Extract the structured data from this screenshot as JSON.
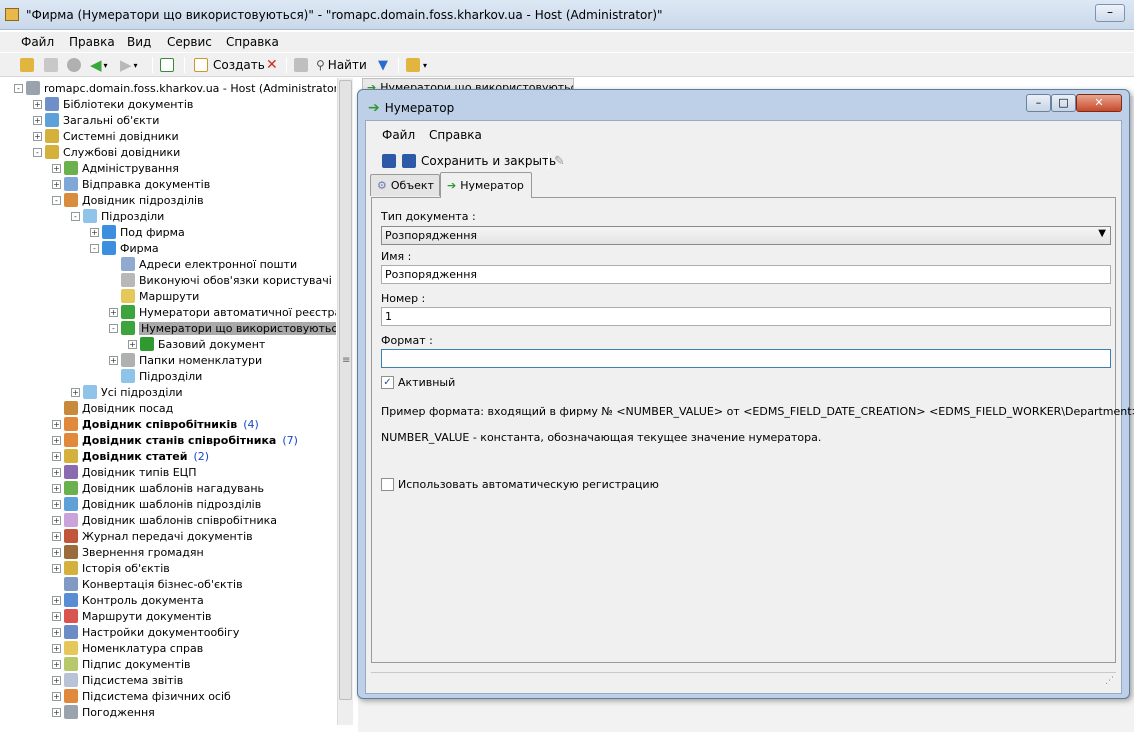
{
  "window": {
    "title": "\"Фирма (Нумератори що використовуються)\" - \"romapc.domain.foss.kharkov.ua - Host (Administrator)\"",
    "min_glyph": "–"
  },
  "menu": [
    "Файл",
    "Правка",
    "Вид",
    "Сервис",
    "Справка"
  ],
  "toolbar": {
    "create_label": "Создать",
    "find_label": "Найти"
  },
  "tree": [
    {
      "label": "romapc.domain.foss.kharkov.ua - Host (Administrator)",
      "depth": 0,
      "exp": "-",
      "icon": "#9aa3ad"
    },
    {
      "label": "Бібліотеки документів",
      "depth": 1,
      "exp": "+",
      "icon": "#6f8fc9"
    },
    {
      "label": "Загальні об'єкти",
      "depth": 1,
      "exp": "+",
      "icon": "#5ea0d8"
    },
    {
      "label": "Системні довідники",
      "depth": 1,
      "exp": "+",
      "icon": "#d4b13d"
    },
    {
      "label": "Службові довідники",
      "depth": 1,
      "exp": "-",
      "icon": "#d4b13d"
    },
    {
      "label": "Адміністрування",
      "depth": 2,
      "exp": "+",
      "icon": "#6ab04c"
    },
    {
      "label": "Відправка документів",
      "depth": 2,
      "exp": "+",
      "icon": "#7fa7d8"
    },
    {
      "label": "Довідник підрозділів",
      "depth": 2,
      "exp": "-",
      "icon": "#d98c3b"
    },
    {
      "label": "Підрозділи",
      "depth": 3,
      "exp": "-",
      "icon": "#8fc3ea"
    },
    {
      "label": "Под фирма",
      "depth": 4,
      "exp": "+",
      "icon": "#3c8fde"
    },
    {
      "label": "Фирма",
      "depth": 4,
      "exp": "-",
      "icon": "#3c8fde"
    },
    {
      "label": "Адреси електронної пошти",
      "depth": 5,
      "exp": "",
      "icon": "#8fa9d1"
    },
    {
      "label": "Виконуючі обов'язки користувачі",
      "depth": 5,
      "exp": "",
      "icon": "#b8b8b8"
    },
    {
      "label": "Маршрути",
      "depth": 5,
      "exp": "",
      "icon": "#e6c75a"
    },
    {
      "label": "Нумератори автоматичної реєстраці",
      "depth": 5,
      "exp": "+",
      "icon": "#3da33d"
    },
    {
      "label": "Нумератори що використовуються",
      "depth": 5,
      "exp": "-",
      "icon": "#3da33d",
      "selected": true
    },
    {
      "label": "Базовий документ",
      "depth": 6,
      "exp": "+",
      "icon": "#2f9a2f"
    },
    {
      "label": "Папки номенклатури",
      "depth": 5,
      "exp": "+",
      "icon": "#b0b0b0"
    },
    {
      "label": "Підрозділи",
      "depth": 5,
      "exp": "",
      "icon": "#8fc3ea"
    },
    {
      "label": "Усі підрозділи",
      "depth": 3,
      "exp": "+",
      "icon": "#8fc3ea"
    },
    {
      "label": "Довідник посад",
      "depth": 2,
      "exp": "",
      "icon": "#c9893b"
    },
    {
      "label": "Довідник співробітників",
      "depth": 2,
      "exp": "+",
      "icon": "#e0893b",
      "bold": true,
      "count": "(4)"
    },
    {
      "label": "Довідник станів співробітника",
      "depth": 2,
      "exp": "+",
      "icon": "#e0893b",
      "bold": true,
      "count": "(7)"
    },
    {
      "label": "Довідник статей",
      "depth": 2,
      "exp": "+",
      "icon": "#d4b13d",
      "bold": true,
      "count": "(2)"
    },
    {
      "label": "Довідник типів ЕЦП",
      "depth": 2,
      "exp": "+",
      "icon": "#8a6bb0"
    },
    {
      "label": "Довідник шаблонів нагадувань",
      "depth": 2,
      "exp": "+",
      "icon": "#6ab04c"
    },
    {
      "label": "Довідник шаблонів підрозділів",
      "depth": 2,
      "exp": "+",
      "icon": "#5ea0d8"
    },
    {
      "label": "Довідник шаблонів співробітника",
      "depth": 2,
      "exp": "+",
      "icon": "#c9a3d9"
    },
    {
      "label": "Журнал передачі документів",
      "depth": 2,
      "exp": "+",
      "icon": "#c2563a"
    },
    {
      "label": "Звернення громадян",
      "depth": 2,
      "exp": "+",
      "icon": "#9a6b3b"
    },
    {
      "label": "Історія об'єктів",
      "depth": 2,
      "exp": "+",
      "icon": "#d4b13d"
    },
    {
      "label": "Конвертація бізнес-об'єктів",
      "depth": 2,
      "exp": "",
      "icon": "#7f9bc3"
    },
    {
      "label": "Контроль документа",
      "depth": 2,
      "exp": "+",
      "icon": "#5a8ed4"
    },
    {
      "label": "Маршрути документів",
      "depth": 2,
      "exp": "+",
      "icon": "#d9534f"
    },
    {
      "label": "Настройки документообігу",
      "depth": 2,
      "exp": "+",
      "icon": "#6b8cc4"
    },
    {
      "label": "Номенклатура справ",
      "depth": 2,
      "exp": "+",
      "icon": "#e6c75a"
    },
    {
      "label": "Підпис документів",
      "depth": 2,
      "exp": "+",
      "icon": "#b5c96a"
    },
    {
      "label": "Підсистема звітів",
      "depth": 2,
      "exp": "+",
      "icon": "#b8c4d6"
    },
    {
      "label": "Підсистема фізичних осіб",
      "depth": 2,
      "exp": "+",
      "icon": "#e0893b"
    },
    {
      "label": "Погодження",
      "depth": 2,
      "exp": "+",
      "icon": "#9aa3ad"
    }
  ],
  "background_tab": {
    "label": "Нумератори що використовуються"
  },
  "dialog": {
    "title": "Нумератор",
    "menu": [
      "Файл",
      "Справка"
    ],
    "save_label": "Сохранить и закрыть",
    "tabs": [
      "Объект",
      "Нумератор"
    ],
    "active_tab": 1,
    "doc_type_label": "Тип документа :",
    "doc_type_value": "Розпорядження",
    "name_label": "Имя :",
    "name_value": "Розпорядження",
    "number_label": "Номер :",
    "number_value": "1",
    "format_label": "Формат :",
    "format_value": "",
    "active_label": "Активный",
    "active_checked": true,
    "example_text": "Пример формата: входящий в фирму № <NUMBER_VALUE> от <EDMS_FIELD_DATE_CREATION> <EDMS_FIELD_WORKER\\Department>",
    "number_value_text": "NUMBER_VALUE - константа, обозначающая текущее значение нумератора.",
    "auto_reg_label": "Использовать автоматическую регистрацию",
    "auto_reg_checked": false
  }
}
